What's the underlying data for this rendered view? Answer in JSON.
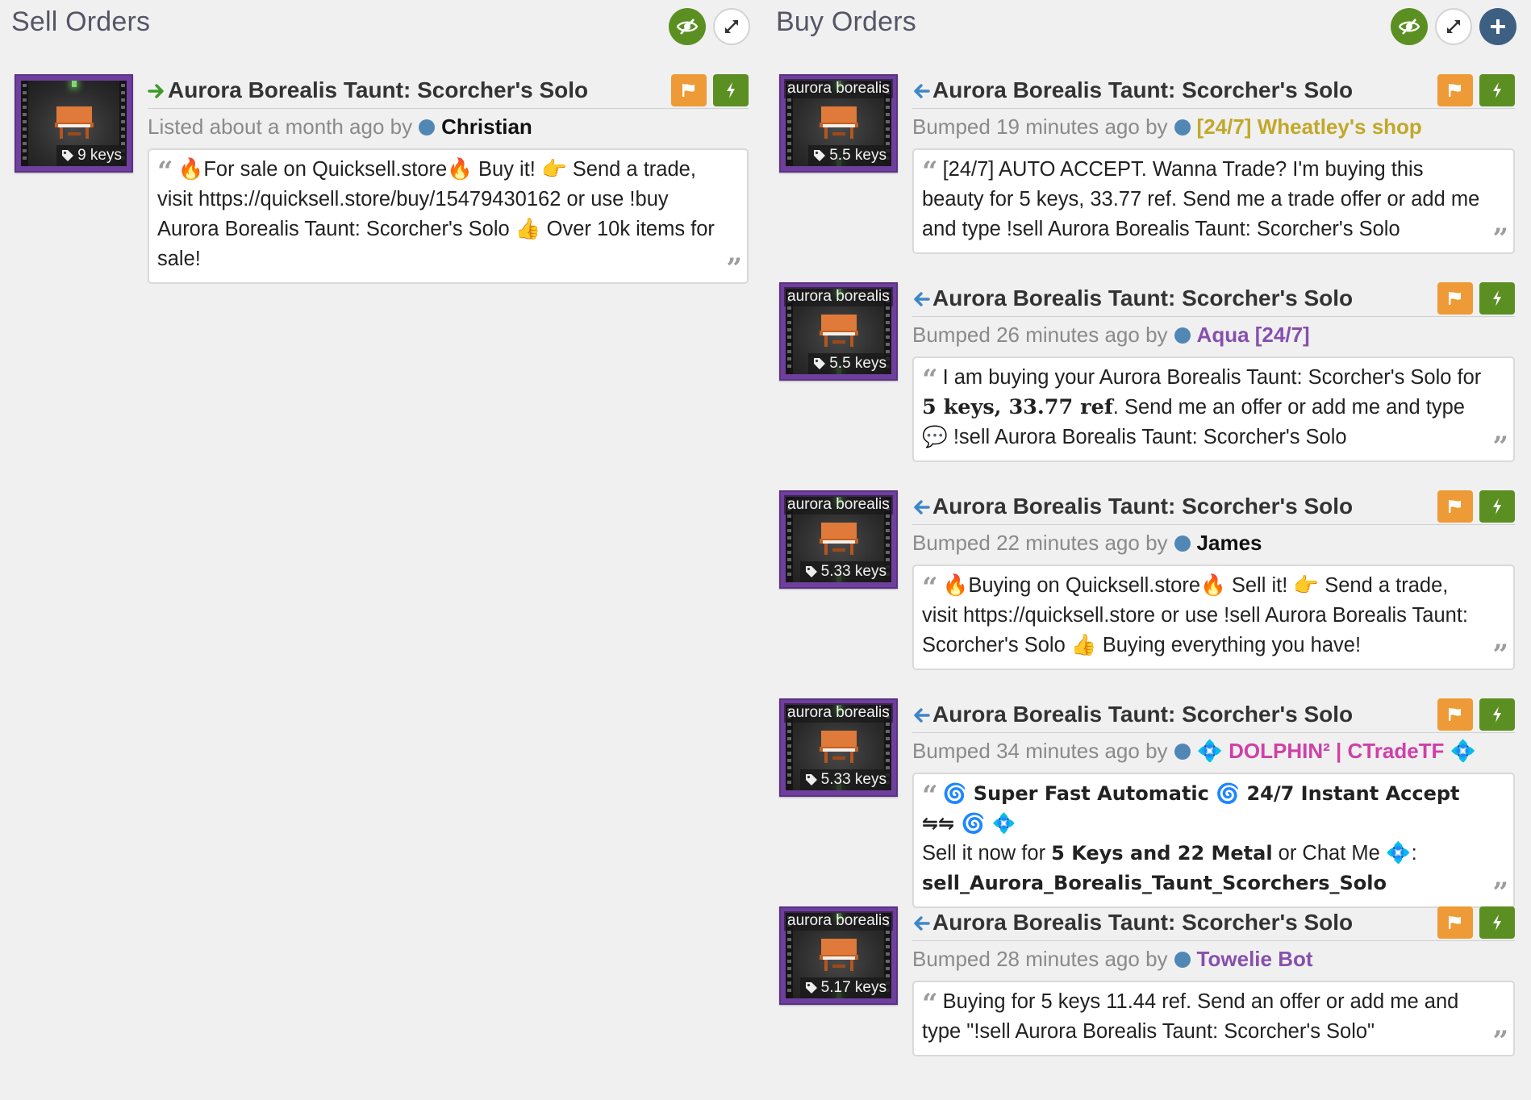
{
  "sell": {
    "title": "Sell Orders",
    "listings": [
      {
        "price": "9 keys",
        "item_name": "Aurora Borealis Taunt: Scorcher's Solo",
        "meta_prefix": "Listed about a month ago by",
        "user": "Christian",
        "message": {
          "a": "🔥For sale on Quicksell.store🔥 Buy it! 👉 Send a trade, visit https://quicksell.store/buy/15479430162 or use !buy Aurora Borealis Taunt: Scorcher's Solo 👍 Over 10k items for sale!"
        }
      }
    ]
  },
  "buy": {
    "title": "Buy Orders",
    "listings": [
      {
        "effect": "aurora borealis",
        "price": "5.5 keys",
        "item_name": "Aurora Borealis Taunt: Scorcher's Solo",
        "meta_prefix": "Bumped 19 minutes ago by",
        "user": "[24/7] Wheatley's shop",
        "message": {
          "a": "[24/7] AUTO ACCEPT. Wanna Trade? I'm buying this beauty for 5 keys, 33.77 ref. Send me a trade offer or add me and type !sell Aurora Borealis Taunt: Scorcher's Solo"
        }
      },
      {
        "effect": "aurora borealis",
        "price": "5.5 keys",
        "item_name": "Aurora Borealis Taunt: Scorcher's Solo",
        "meta_prefix": "Bumped 26 minutes ago by",
        "user": "Aqua [24/7]",
        "message": {
          "a": "I am buying your Aurora Borealis Taunt: Scorcher's Solo for",
          "b": "5 keys, 33.77 ref",
          "c": ". Send me an offer or add me and type 💬 !sell Aurora Borealis Taunt: Scorcher's Solo"
        }
      },
      {
        "effect": "aurora borealis",
        "price": "5.33 keys",
        "item_name": "Aurora Borealis Taunt: Scorcher's Solo",
        "meta_prefix": "Bumped 22 minutes ago by",
        "user": "James",
        "message": {
          "a": "🔥Buying on Quicksell.store🔥 Sell it! 👉 Send a trade, visit https://quicksell.store or use !sell Aurora Borealis Taunt: Scorcher's Solo 👍 Buying everything you have!"
        }
      },
      {
        "effect": "aurora borealis",
        "price": "5.33 keys",
        "item_name": "Aurora Borealis Taunt: Scorcher's Solo",
        "meta_prefix": "Bumped 34 minutes ago by",
        "user": "💠 DOLPHIN² | CTradeTF 💠",
        "message": {
          "a": "🌀 Super Fast Automatic 🌀 24/7 Instant Accept ⇋⇋ 🌀 💠",
          "b": "Sell it now for",
          "c": "5 Keys and 22 Metal",
          "d": "or Chat Me 💠:",
          "e": "sell_Aurora_Borealis_Taunt_Scorchers_Solo"
        }
      },
      {
        "effect": "aurora borealis",
        "price": "5.17 keys",
        "item_name": "Aurora Borealis Taunt: Scorcher's Solo",
        "meta_prefix": "Bumped 28 minutes ago by",
        "user": "Towelie Bot",
        "message": {
          "a": "Buying for 5 keys 11.44 ref. Send an offer or add me and type \"!sell Aurora Borealis Taunt: Scorcher's Solo\""
        }
      }
    ]
  },
  "icons": {
    "hide": "eye-slash-icon",
    "expand": "expand-icon",
    "add": "plus-icon",
    "report": "flag-icon",
    "bump": "bolt-icon",
    "price_tag": "tag-icon",
    "sell_intent": "arrow-right-icon",
    "buy_intent": "arrow-left-icon",
    "quote_open": "quote-left-icon",
    "quote_close": "quote-right-icon"
  },
  "colors": {
    "sell_arrow": "#3c9a28",
    "buy_arrow": "#3f86c7",
    "bump_green": "#5b8f22",
    "report_orange": "#ee9a37",
    "unusual_purple": "#6f3f9e",
    "user_gold": "#c1a829",
    "user_purple": "#8650ac",
    "user_pink": "#cf3fa8",
    "online_dot": "#5187b4"
  }
}
